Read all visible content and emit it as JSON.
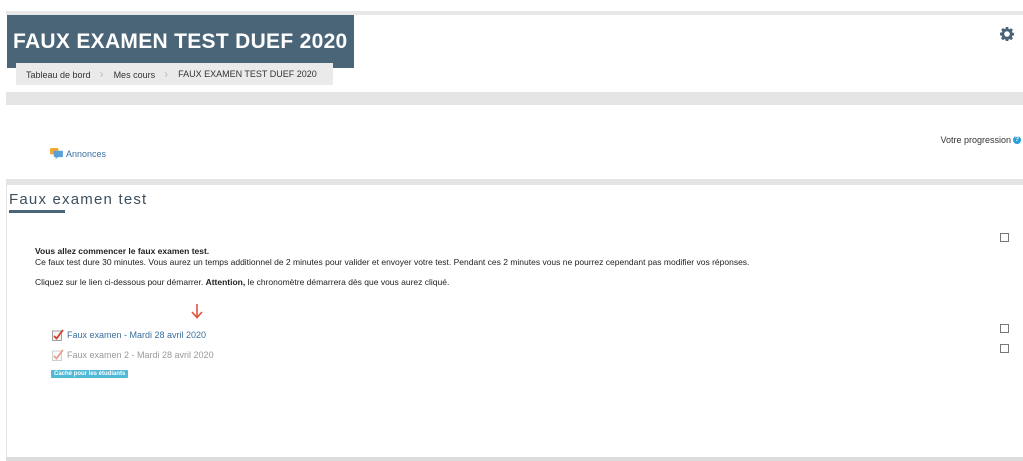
{
  "course": {
    "title": "FAUX EXAMEN TEST DUEF 2020"
  },
  "breadcrumb": [
    "Tableau de bord",
    "Mes cours",
    "FAUX EXAMEN TEST DUEF 2020"
  ],
  "header": {
    "settings_icon": "gear-icon"
  },
  "progress": {
    "label": "Votre progression",
    "help_icon": "question-circle-icon",
    "help_glyph": "?"
  },
  "general_section": {
    "forum": {
      "label": "Annonces",
      "icon": "forum-icon"
    }
  },
  "section": {
    "title": "Faux examen test",
    "intro": {
      "heading": "Vous allez commencer le faux examen test.",
      "line1": "Ce faux test dure 30 minutes. Vous aurez un temps additionnel de 2 minutes pour valider et envoyer votre test. Pendant ces 2 minutes vous ne pourrez cependant pas modifier vos réponses.",
      "line2_before": "Cliquez sur le lien ci-dessous pour démarrer. ",
      "line2_bold": "Attention,",
      "line2_after": " le chronomètre démarrera dès que vous aurez cliqué."
    },
    "activities": [
      {
        "label": "Faux examen - Mardi 28 avril 2020",
        "icon": "quiz-icon"
      },
      {
        "label": "Faux examen 2 - Mardi 28 avril 2020",
        "icon": "quiz-icon",
        "badge": "Caché pour les étudiants"
      }
    ]
  },
  "colors": {
    "title_bg": "#4a6478",
    "link": "#3a6fa0",
    "badge": "#4fb9d6",
    "arrow": "#e0503c"
  }
}
